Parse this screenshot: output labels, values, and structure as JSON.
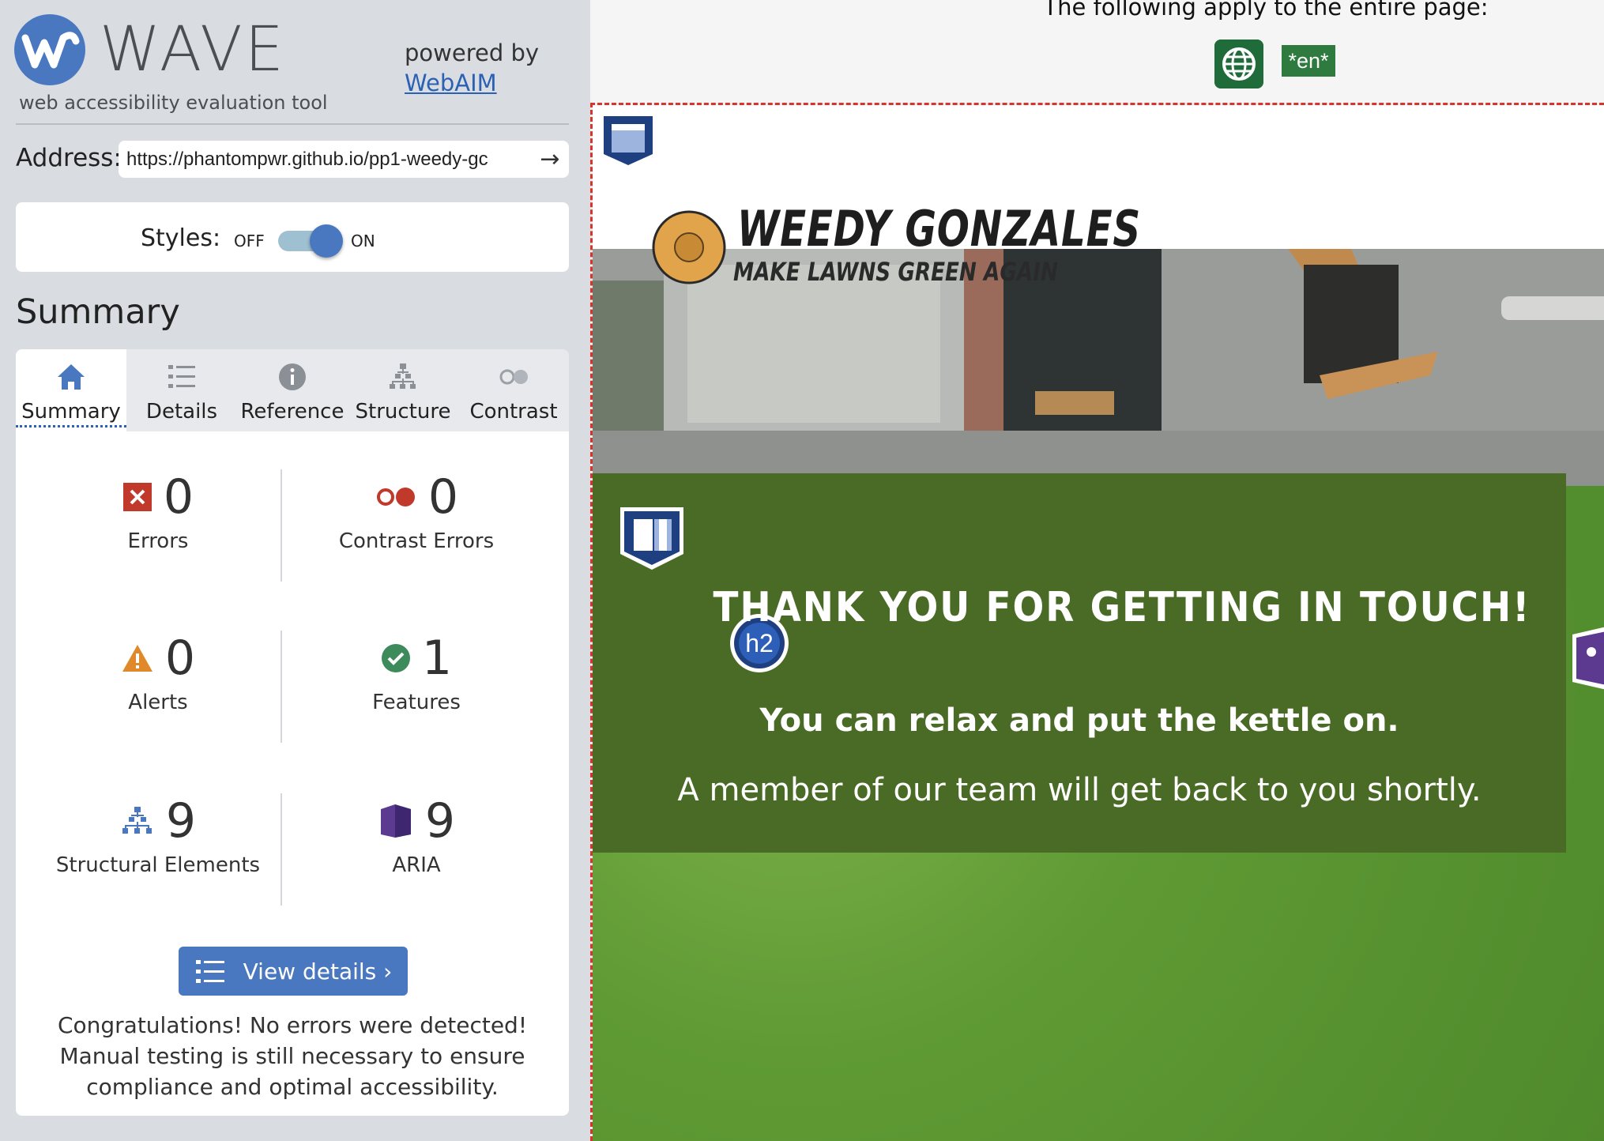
{
  "wave": {
    "title": "WAVE",
    "subtitle": "web accessibility evaluation tool",
    "powered_by": "powered by",
    "powered_by_link": "WebAIM",
    "address_label": "Address:",
    "address_value": "https://phantompwr.github.io/pp1-weedy-gc",
    "styles_label": "Styles:",
    "styles_off": "OFF",
    "styles_on": "ON",
    "styles_enabled": true,
    "summary_heading": "Summary",
    "tabs": [
      {
        "label": "Summary",
        "icon": "home-icon",
        "active": true
      },
      {
        "label": "Details",
        "icon": "list-icon",
        "active": false
      },
      {
        "label": "Reference",
        "icon": "info-icon",
        "active": false
      },
      {
        "label": "Structure",
        "icon": "hierarchy-icon",
        "active": false
      },
      {
        "label": "Contrast",
        "icon": "contrast-icon",
        "active": false
      }
    ],
    "stats": {
      "errors": {
        "count": "0",
        "label": "Errors",
        "icon": "error-icon",
        "color": "#c0392b"
      },
      "contrast_errors": {
        "count": "0",
        "label": "Contrast Errors",
        "icon": "contrast-error-icon",
        "color": "#c0392b"
      },
      "alerts": {
        "count": "0",
        "label": "Alerts",
        "icon": "alert-icon",
        "color": "#e0892b"
      },
      "features": {
        "count": "1",
        "label": "Features",
        "icon": "feature-icon",
        "color": "#3d8a5a"
      },
      "structural": {
        "count": "9",
        "label": "Structural Elements",
        "icon": "structure-icon",
        "color": "#4a78c0"
      },
      "aria": {
        "count": "9",
        "label": "ARIA",
        "icon": "aria-icon",
        "color": "#5b3a8f"
      }
    },
    "view_details_label": "View details ›",
    "congrats": "Congratulations! No errors were detected! Manual testing is still necessary to ensure compliance and optimal accessibility."
  },
  "preview": {
    "notice": "The following apply to the entire page:",
    "lang_badge": "*en*",
    "brand_name": "WEEDY GONZALES",
    "brand_tagline": "MAKE LAWNS GREEN AGAIN",
    "h2_badge": "h2",
    "heading": "THANK YOU FOR GETTING IN TOUCH!",
    "line1": "You can relax and put the kettle on.",
    "line2": "A member of our team will get back to you shortly."
  }
}
